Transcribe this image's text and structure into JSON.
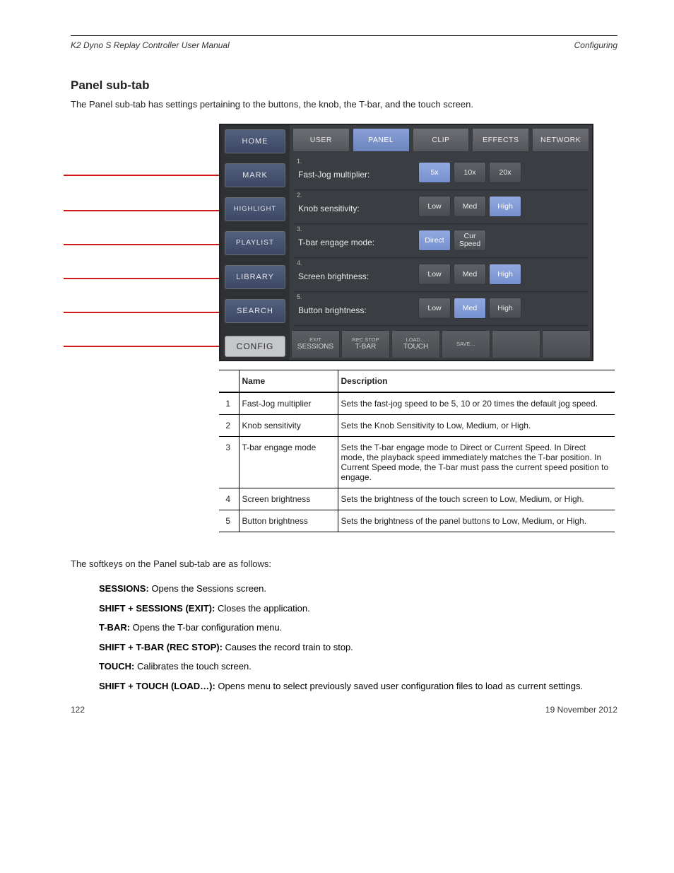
{
  "header": {
    "left": "K2 Dyno S Replay Controller User Manual",
    "right": "Configuring"
  },
  "section1": {
    "title": "Panel sub-tab",
    "body": "The Panel sub-tab has settings pertaining to the buttons, the knob, the T-bar, and the touch screen."
  },
  "screenshot": {
    "sidebar": [
      {
        "label": "HOME"
      },
      {
        "label": "MARK"
      },
      {
        "label": "HIGHLIGHT"
      },
      {
        "label": "PLAYLIST"
      },
      {
        "label": "LIBRARY"
      },
      {
        "label": "SEARCH"
      }
    ],
    "config_label": "CONFIG",
    "tabs": [
      {
        "label": "USER",
        "active": false
      },
      {
        "label": "PANEL",
        "active": true
      },
      {
        "label": "CLIP",
        "active": false
      },
      {
        "label": "EFFECTS",
        "active": false
      },
      {
        "label": "NETWORK",
        "active": false
      }
    ],
    "rows": [
      {
        "n": "1.",
        "label": "Fast-Jog multiplier:",
        "opts": [
          {
            "t": "5x",
            "sel": true
          },
          {
            "t": "10x"
          },
          {
            "t": "20x"
          }
        ]
      },
      {
        "n": "2.",
        "label": "Knob sensitivity:",
        "opts": [
          {
            "t": "Low"
          },
          {
            "t": "Med"
          },
          {
            "t": "High",
            "sel": true
          }
        ]
      },
      {
        "n": "3.",
        "label": "T-bar engage mode:",
        "opts": [
          {
            "t": "Direct",
            "sel": true
          },
          {
            "t": "Cur\nSpeed"
          }
        ]
      },
      {
        "n": "4.",
        "label": "Screen brightness:",
        "opts": [
          {
            "t": "Low"
          },
          {
            "t": "Med"
          },
          {
            "t": "High",
            "sel": true
          }
        ]
      },
      {
        "n": "5.",
        "label": "Button brightness:",
        "opts": [
          {
            "t": "Low"
          },
          {
            "t": "Med",
            "sel": true
          },
          {
            "t": "High"
          }
        ]
      }
    ],
    "bottom": [
      {
        "tiny": "EXIT",
        "main": "SESSIONS"
      },
      {
        "tiny": "REC STOP",
        "main": "T-BAR"
      },
      {
        "tiny": "LOAD…",
        "main": "TOUCH"
      },
      {
        "tiny": "SAVE…",
        "main": ""
      },
      {
        "tiny": "",
        "main": ""
      },
      {
        "tiny": "",
        "main": ""
      }
    ]
  },
  "table": {
    "head": [
      "",
      "Name",
      "Description"
    ],
    "rows": [
      {
        "n": "1",
        "name": "Fast-Jog multiplier",
        "desc": "Sets the fast-jog speed to be 5, 10 or 20 times the default jog speed."
      },
      {
        "n": "2",
        "name": "Knob sensitivity",
        "desc": "Sets the Knob Sensitivity to Low, Medium, or High."
      },
      {
        "n": "3",
        "name": "T-bar engage mode",
        "desc": "Sets the T-bar engage mode to Direct or Current Speed. In Direct mode, the playback speed immediately matches the T-bar position. In Current Speed mode, the T-bar must pass the current speed position to engage."
      },
      {
        "n": "4",
        "name": "Screen brightness",
        "desc": "Sets the brightness of the touch screen to Low, Medium, or High."
      },
      {
        "n": "5",
        "name": "Button brightness",
        "desc": "Sets the brightness of the panel buttons to Low, Medium, or High."
      }
    ]
  },
  "softkeys": {
    "intro": "The softkeys on the Panel sub-tab are as follows:",
    "items": [
      {
        "label": "SESSIONS:",
        "text": "Opens the Sessions screen."
      },
      {
        "label": "SHIFT + SESSIONS (EXIT):",
        "text": "Closes the application."
      },
      {
        "label": "T-BAR:",
        "text": "Opens the T-bar configuration menu."
      },
      {
        "label": "SHIFT + T-BAR (REC STOP):",
        "text": "Causes the record train to stop."
      },
      {
        "label": "TOUCH:",
        "text": "Calibrates the touch screen."
      },
      {
        "label": "SHIFT + TOUCH (LOAD…):",
        "text": "Opens menu to select previously saved user configuration files to load as current settings."
      }
    ]
  },
  "footer": {
    "page": "122",
    "date": "19 November 2012"
  }
}
